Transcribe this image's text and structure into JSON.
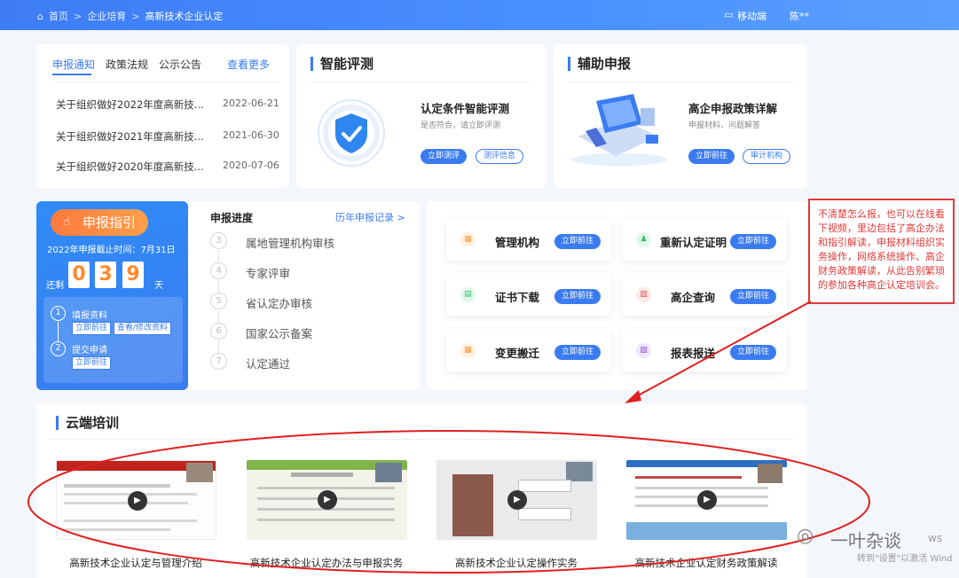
{
  "breadcrumb": {
    "home": "首页",
    "section": "企业培育",
    "current": "高新技术企业认定"
  },
  "topbar": {
    "mobile": "移动端",
    "user": "陈**"
  },
  "news": {
    "tabs": [
      "申报通知",
      "政策法规",
      "公示公告"
    ],
    "more": "查看更多",
    "items": [
      {
        "title": "关于组织做好2022年度高新技...",
        "date": "2022-06-21"
      },
      {
        "title": "关于组织做好2021年度高新技...",
        "date": "2021-06-30"
      },
      {
        "title": "关于组织做好2020年度高新技...",
        "date": "2020-07-06"
      }
    ]
  },
  "smart": {
    "title": "智能评测",
    "heading": "认定条件智能评测",
    "sub": "是否符合，请立即评测",
    "btn1": "立即测评",
    "btn2": "测评信息"
  },
  "assist": {
    "title": "辅助申报",
    "heading": "高企申报政策详解",
    "sub": "申报材料、问题解答",
    "btn1": "立即前往",
    "btn2": "审计机构"
  },
  "guide": {
    "btn": "申报指引",
    "deadline": "2022年申报截止时间：7月31日",
    "remain": "还剩",
    "d1": "0",
    "d2": "3",
    "d3": "9",
    "day": "天",
    "s1": "填报资料",
    "s1a": "立即前往",
    "s1b": "查看/修改资料",
    "s2": "提交申请",
    "s2a": "立即前往"
  },
  "progress": {
    "title": "申报进度",
    "link": "历年申报记录 >",
    "steps": [
      "属地管理机构审核",
      "专家评审",
      "省认定办审核",
      "国家公示备案",
      "认定通过"
    ],
    "nums": [
      "3",
      "4",
      "5",
      "6",
      "7"
    ]
  },
  "services": {
    "go": "立即前往",
    "items": [
      "管理机构",
      "重新认定证明",
      "证书下载",
      "高企查询",
      "变更搬迁",
      "报表报送"
    ]
  },
  "note": "不清楚怎么报，也可以在线看下视频，里边包括了高企办法和指引解读，申报材料组织实务操作，网络系统操作、高企财务政策解读，从此告别繁琐的参加各种高企认定培训会。",
  "cloud": {
    "title": "云端培训",
    "videos": [
      "高新技术企业认定与管理介绍",
      "高新技术企业认定办法与申报实务",
      "高新技术企业认定操作实务",
      "高新技术企业认定财务政策解读"
    ]
  },
  "watermark": {
    "brand": "一叶杂谈",
    "activate": "转到\"设置\"以激活 Wind",
    "ws": "ws"
  },
  "colors": {
    "accent": "#3a7cf0",
    "orange": "#ff8a2a",
    "red": "#e03a3a"
  }
}
